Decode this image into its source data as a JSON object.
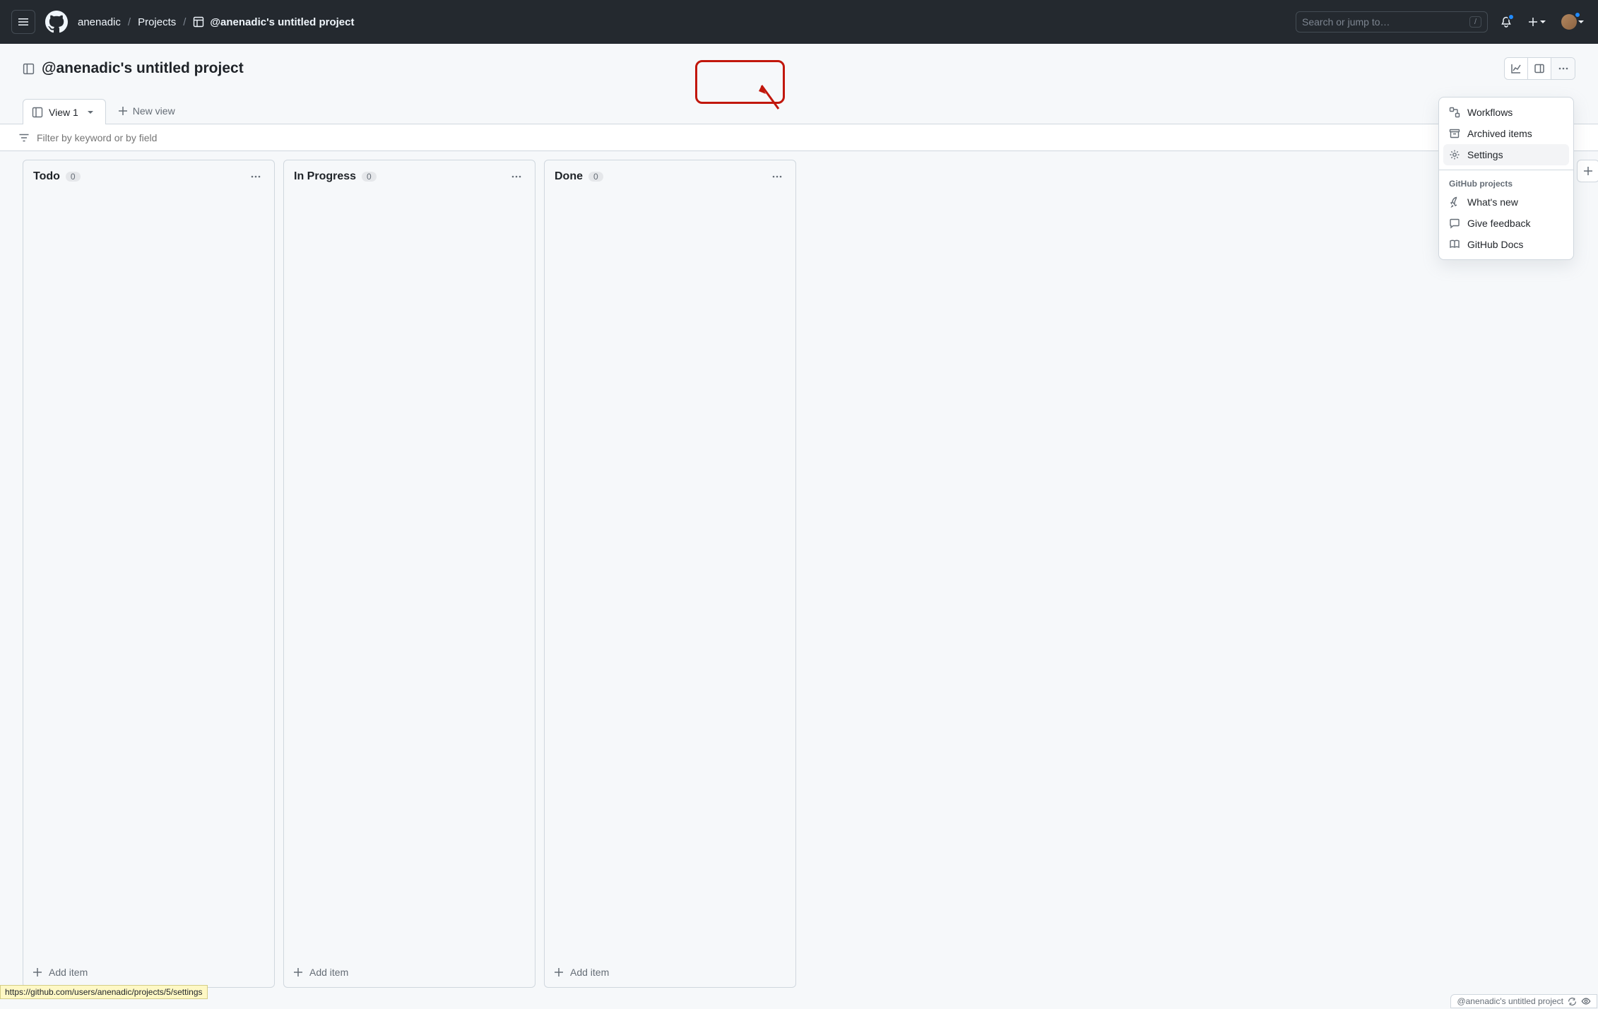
{
  "topbar": {
    "breadcrumb": {
      "user": "anenadic",
      "projects": "Projects",
      "current": "@anenadic's untitled project"
    },
    "search_placeholder": "Search or jump to…",
    "search_kbd": "/"
  },
  "subbar": {
    "title": "@anenadic's untitled project"
  },
  "tabs": {
    "view1": "View 1",
    "new_view": "New view"
  },
  "filter": {
    "placeholder": "Filter by keyword or by field"
  },
  "columns": [
    {
      "title": "Todo",
      "count": "0",
      "add": "Add item"
    },
    {
      "title": "In Progress",
      "count": "0",
      "add": "Add item"
    },
    {
      "title": "Done",
      "count": "0",
      "add": "Add item"
    }
  ],
  "dropdown": {
    "workflows": "Workflows",
    "archived": "Archived items",
    "settings": "Settings",
    "section": "GitHub projects",
    "whatsnew": "What's new",
    "feedback": "Give feedback",
    "docs": "GitHub Docs"
  },
  "status_url": "https://github.com/users/anenadic/projects/5/settings",
  "status_right": "@anenadic's untitled project"
}
